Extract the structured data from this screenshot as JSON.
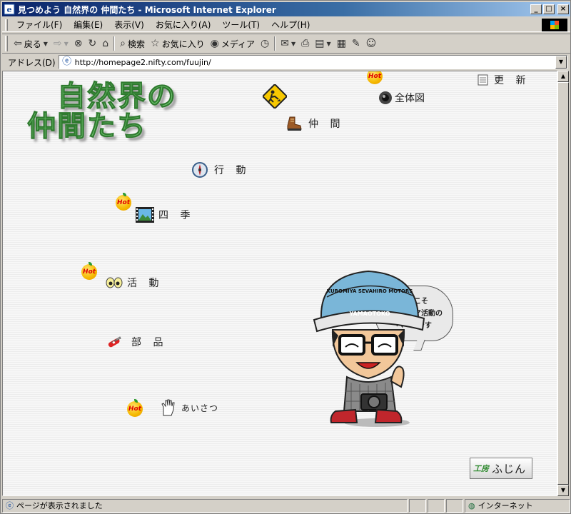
{
  "window": {
    "title": "見つめよう 自然界の 仲間たち - Microsoft Internet Explorer",
    "buttons": {
      "minimize": "_",
      "maximize": "□",
      "close": "×"
    }
  },
  "menu": [
    "ファイル(F)",
    "編集(E)",
    "表示(V)",
    "お気に入り(A)",
    "ツール(T)",
    "ヘルプ(H)"
  ],
  "toolbar": {
    "back": "戻る",
    "search": "検索",
    "favorites": "お気に入り",
    "media": "メディア"
  },
  "address": {
    "label": "アドレス(D)",
    "url": "http://homepage2.nifty.com/fuujin/"
  },
  "page": {
    "title_line1": "自然界の",
    "title_line2": "仲間たち",
    "hot_label": "Hot",
    "nav": {
      "update": "更 新",
      "overview": "全体図",
      "friends": "仲 間",
      "behavior": "行 動",
      "seasons": "四 季",
      "activities": "活 動",
      "parts": "部 品",
      "greeting": "あいさつ"
    },
    "bubble": [
      "ようこそ",
      "アウトドア活動の",
      "ページです"
    ],
    "cap_text_front": "YAMAOTOKO",
    "cap_text_top": "KUROMIYA SEVAHIRO MOTORS",
    "studio_badge": {
      "prefix": "工房",
      "name": "ふじん"
    }
  },
  "status": {
    "message": "ページが表示されました",
    "zone": "インターネット"
  }
}
